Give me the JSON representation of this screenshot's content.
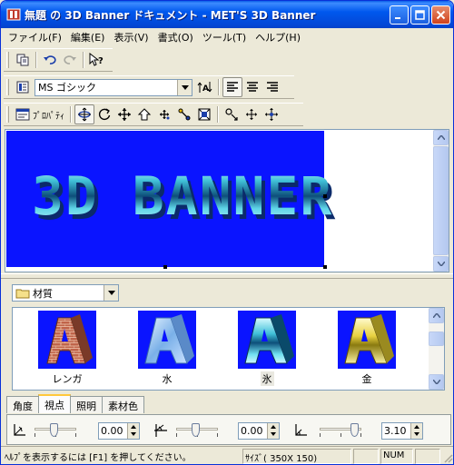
{
  "window": {
    "title": "無題 の 3D Banner ドキュメント - MET'S 3D Banner"
  },
  "menu": [
    "ファイル(F)",
    "編集(E)",
    "表示(V)",
    "書式(O)",
    "ツール(T)",
    "ヘルプ(H)"
  ],
  "toolbar3": {
    "properties_label": "ﾌﾟﾛﾊﾟﾃｨ"
  },
  "font": {
    "selected": "MS ゴシック"
  },
  "canvas": {
    "banner_text": "3D BANNER",
    "banner_color": "#0a14ff"
  },
  "materials": {
    "category": "材質",
    "items": [
      {
        "label": "レンガ",
        "texture": "brick"
      },
      {
        "label": "水",
        "texture": "water"
      },
      {
        "label": "氷",
        "texture": "ice"
      },
      {
        "label": "金",
        "texture": "gold"
      }
    ],
    "selected_index": 2
  },
  "tabs": [
    "角度",
    "視点",
    "照明",
    "素材色"
  ],
  "active_tab": 1,
  "controls": [
    {
      "icon": "rotate-x-icon",
      "value": "0.00"
    },
    {
      "icon": "rotate-y-icon",
      "value": "0.00"
    },
    {
      "icon": "rotate-z-icon",
      "value": "3.10"
    }
  ],
  "status": {
    "help": "ﾍﾙﾌﾟを表示するには [F1] を押してください。",
    "size": "ｻｲｽﾞ( 350X 150)",
    "num": "NUM"
  }
}
